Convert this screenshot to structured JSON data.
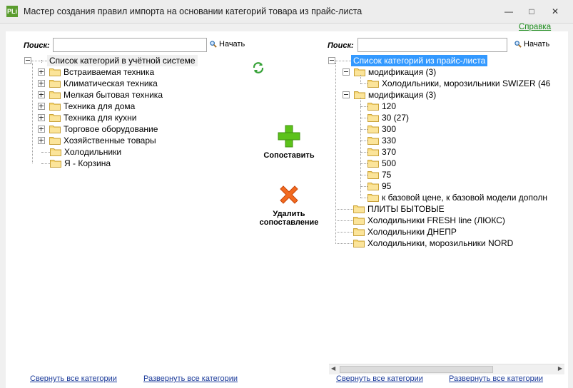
{
  "window": {
    "title": "Мастер создания правил импорта на основании категорий товара из прайс-листа",
    "app_icon_text": "PLi"
  },
  "help_link": "Справка",
  "left_panel": {
    "search_label": "Поиск:",
    "search_value": "",
    "start_label": "Начать",
    "root_label": "Список категорий в учётной системе",
    "items": [
      {
        "label": "Встраиваемая техника",
        "expandable": true
      },
      {
        "label": "Климатическая техника",
        "expandable": true
      },
      {
        "label": "Мелкая бытовая техника",
        "expandable": true
      },
      {
        "label": "Техника для дома",
        "expandable": true
      },
      {
        "label": "Техника для кухни",
        "expandable": true
      },
      {
        "label": "Торговое оборудование",
        "expandable": true
      },
      {
        "label": "Хозяйственные товары",
        "expandable": true
      },
      {
        "label": "Холодильники",
        "expandable": false
      },
      {
        "label": "Я - Корзина",
        "expandable": false
      }
    ],
    "collapse_all": "Свернуть все категории",
    "expand_all": "Развернуть все категории"
  },
  "actions": {
    "match_label": "Сопоставить",
    "delete_line1": "Удалить",
    "delete_line2": "сопоставление",
    "refresh_icon": "refresh-icon",
    "add_icon": "plus-icon",
    "delete_icon": "x-icon"
  },
  "right_panel": {
    "search_label": "Поиск:",
    "search_value": "",
    "start_label": "Начать",
    "root_label": "Список категорий из прайс-листа",
    "groups": [
      {
        "label": "модификация (3)",
        "children": [
          "Холодильники, морозильники SWIZER (46"
        ]
      },
      {
        "label": "модификация (3)",
        "children": [
          "120",
          "30 (27)",
          "300",
          "330",
          "370",
          "500",
          "75",
          "95",
          "к базовой цене, к базовой модели дополн"
        ]
      }
    ],
    "items": [
      "ПЛИТЫ БЫТОВЫЕ",
      "Холодильники FRESH line (ЛЮКС)",
      "Холодильники ДНЕПР",
      "Холодильники, морозильники NORD"
    ],
    "collapse_all": "Свернуть все категории",
    "expand_all": "Развернуть все категории"
  },
  "colors": {
    "selection": "#3399ff",
    "link": "#1a3a9a",
    "help_link": "#1a8a1a",
    "plus_green": "#5cc21a",
    "x_orange": "#f26a1f"
  }
}
